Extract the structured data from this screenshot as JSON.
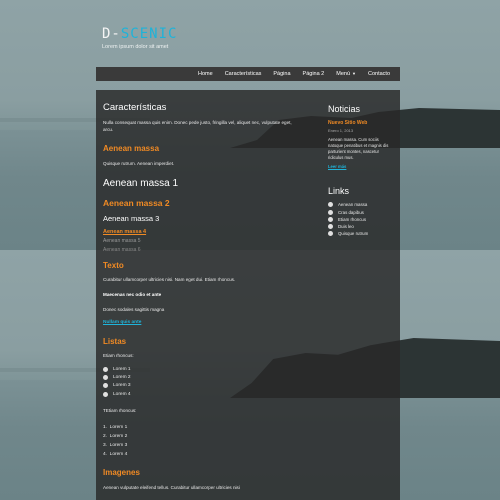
{
  "header": {
    "title_main": "D-",
    "title_accent": "SCENIC",
    "tagline": "Lorem ipsum dolor sit amet"
  },
  "nav": {
    "items": [
      "Home",
      "Características",
      "Página",
      "Página 2",
      "Menú",
      "Contacto"
    ]
  },
  "main": {
    "title": "Características",
    "intro": "Nulla consequat massa quis enim. Donec pede justo, fringilla vel, aliquet nec, vulputate eget, arcu.",
    "section1": {
      "heading": "Aenean massa",
      "text": "Quisque rutrum. Aenean imperdiet."
    },
    "headings": {
      "h1": "Aenean massa 1",
      "h2": "Aenean massa 2",
      "h3": "Aenean massa 3",
      "h4": "Aenean massa 4",
      "h5": "Aenean massa 5",
      "h6": "Aenean massa 6"
    },
    "texto": {
      "heading": "Texto",
      "p1": "Curabitur ullamcorper ultricies nisi. Nam eget dui. Etiam rhoncus.",
      "bold": "Maecenas nec odio et ante",
      "p2": "Donec sodales sagittis magna",
      "link": "Nullam quis ante"
    },
    "listas": {
      "heading": "Listas",
      "ul_label": "Etiam rhoncus:",
      "ul": [
        "Lorem 1",
        "Lorem 2",
        "Lorem 3",
        "Lorem 4"
      ],
      "ol_label": "TEtiam rhoncus:",
      "ol": [
        "Lorem 1",
        "Lorem 2",
        "Lorem 3",
        "Lorem 4"
      ]
    },
    "imagenes": {
      "heading": "Imagenes",
      "text": "Aenean vulputate eleifend tellus. Curabitur ullamcorper ultricies nisi"
    }
  },
  "sidebar": {
    "news_heading": "Noticias",
    "news_title": "Nuevo Sitio Web",
    "news_date": "Enero 1, 2013",
    "news_text": "Aenean massa. Cum sociis natoque penatibus et magnis dis parturient montes, nascetur ridiculus mus.",
    "news_more": "Leer más",
    "links_heading": "Links",
    "links": [
      "Aenean massa",
      "Cras dapibus",
      "Etiam rhoncus",
      "Duis leo",
      "Quisque rutrum"
    ]
  },
  "colors": {
    "accent_blue": "#1fb3d9",
    "accent_orange": "#f08a24",
    "nav_bg": "#3a3a3a",
    "panel_bg": "rgba(40,40,40,0.82)"
  }
}
